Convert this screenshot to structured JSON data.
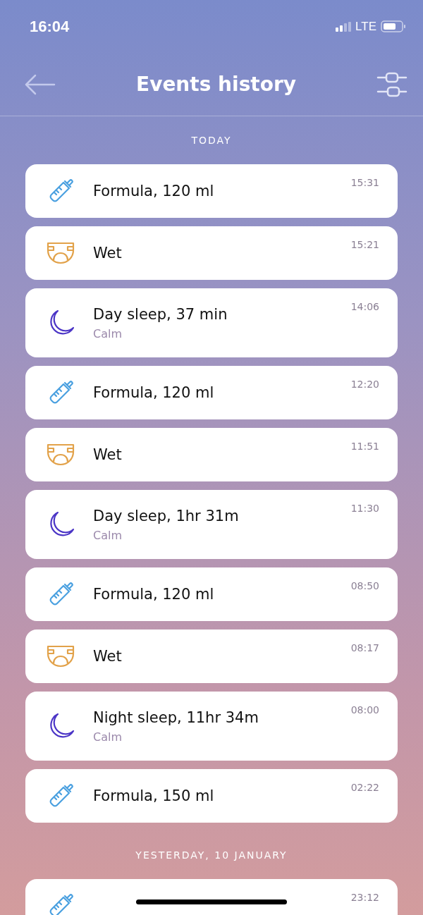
{
  "status_bar": {
    "time": "16:04",
    "network": "LTE"
  },
  "header": {
    "title": "Events history"
  },
  "sections": [
    {
      "title": "TODAY",
      "events": [
        {
          "kind": "feeding",
          "title": "Formula, 120 ml",
          "time": "15:31"
        },
        {
          "kind": "diaper",
          "title": "Wet",
          "time": "15:21"
        },
        {
          "kind": "sleep",
          "title": "Day sleep, 37 min",
          "subtitle": "Calm",
          "time": "14:06"
        },
        {
          "kind": "feeding",
          "title": "Formula, 120 ml",
          "time": "12:20"
        },
        {
          "kind": "diaper",
          "title": "Wet",
          "time": "11:51"
        },
        {
          "kind": "sleep",
          "title": "Day sleep, 1hr 31m",
          "subtitle": "Calm",
          "time": "11:30"
        },
        {
          "kind": "feeding",
          "title": "Formula, 120 ml",
          "time": "08:50"
        },
        {
          "kind": "diaper",
          "title": "Wet",
          "time": "08:17"
        },
        {
          "kind": "sleep",
          "title": "Night sleep, 11hr 34m",
          "subtitle": "Calm",
          "time": "08:00"
        },
        {
          "kind": "feeding",
          "title": "Formula, 150 ml",
          "time": "02:22"
        }
      ]
    },
    {
      "title": "YESTERDAY, 10 JANUARY",
      "events": [
        {
          "kind": "feeding",
          "time": "23:12"
        }
      ]
    }
  ]
}
